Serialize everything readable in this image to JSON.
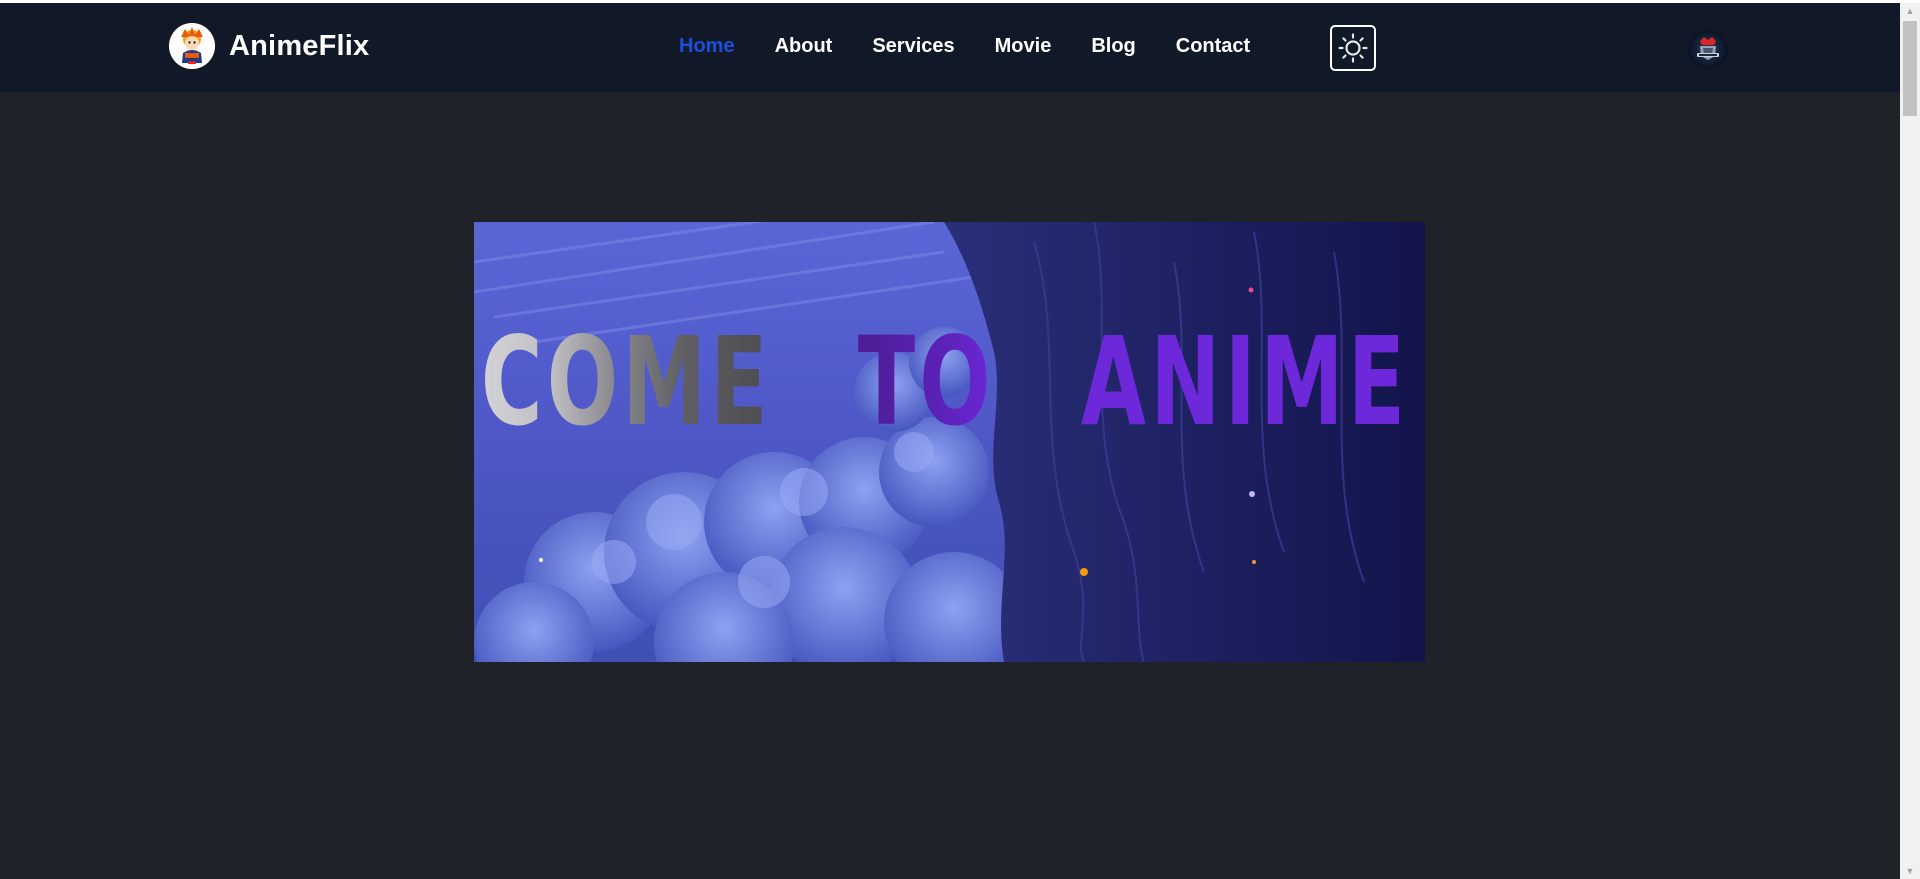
{
  "brand": {
    "name": "AnimeFlix"
  },
  "nav": {
    "items": [
      {
        "label": "Home",
        "active": true
      },
      {
        "label": "About",
        "active": false
      },
      {
        "label": "Services",
        "active": false
      },
      {
        "label": "Movie",
        "active": false
      },
      {
        "label": "Blog",
        "active": false
      },
      {
        "label": "Contact",
        "active": false
      }
    ]
  },
  "icons": {
    "theme_toggle": "sun-icon",
    "avatar": "user-avatar"
  },
  "hero": {
    "banner_text": "COME TO ANIME",
    "words": [
      "COME",
      "TO",
      "ANIME"
    ]
  },
  "colors": {
    "page_background": "#1f2329",
    "navbar_background": "#111827",
    "nav_active": "#1d4ed8",
    "nav_text": "#ffffff",
    "anime_purple": "#6d28d9"
  }
}
